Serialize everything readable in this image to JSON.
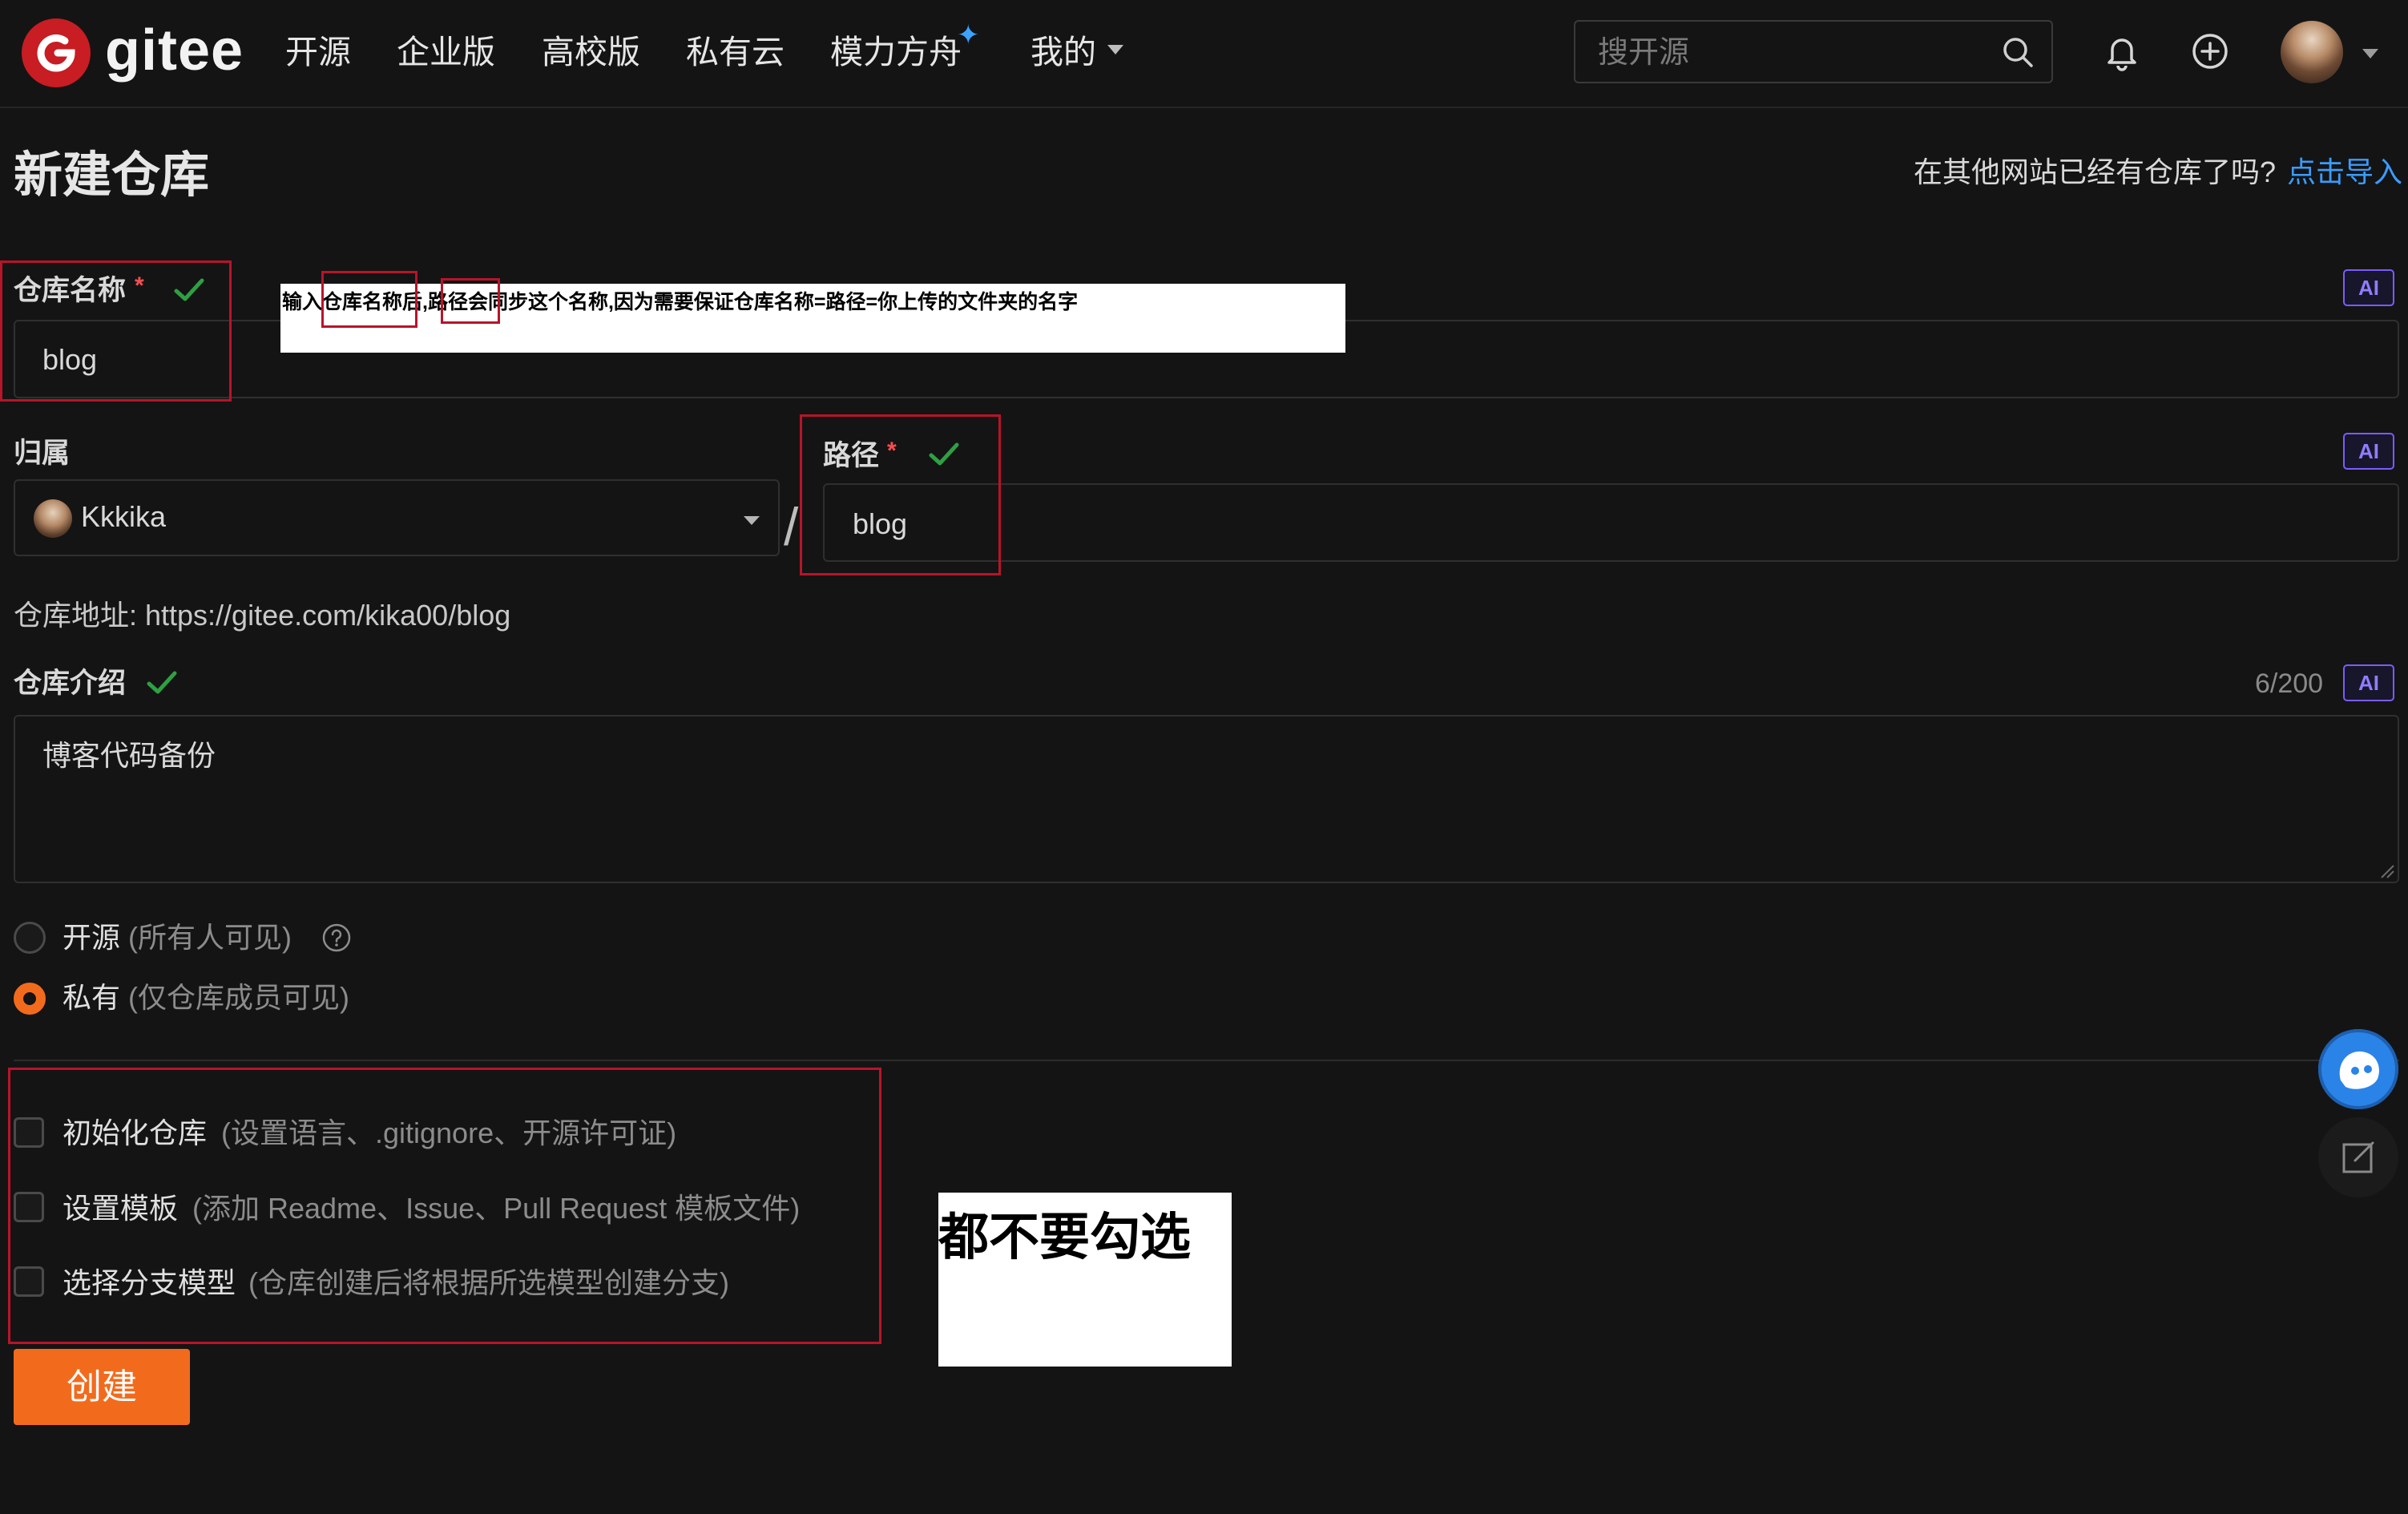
{
  "nav": {
    "brand": "gitee",
    "items": [
      "开源",
      "企业版",
      "高校版",
      "私有云",
      "模力方舟",
      "我的"
    ],
    "search_placeholder": "搜开源"
  },
  "page": {
    "title": "新建仓库",
    "import_question": "在其他网站已经有仓库了吗?",
    "import_link": "点击导入"
  },
  "form": {
    "repo_name_label": "仓库名称",
    "repo_name_value": "blog",
    "required_mark": "*",
    "ai_label": "AI",
    "owner_label": "归属",
    "owner_value": "Kkkika",
    "separator": "/",
    "path_label": "路径",
    "path_value": "blog",
    "repo_url": "仓库地址: https://gitee.com/kika00/blog",
    "intro_label": "仓库介绍",
    "intro_counter": "6/200",
    "intro_value": "博客代码备份",
    "visibility": [
      {
        "label": "开源",
        "hint": "(所有人可见)",
        "selected": false
      },
      {
        "label": "私有",
        "hint": "(仅仓库成员可见)",
        "selected": true
      }
    ],
    "options": [
      {
        "label": "初始化仓库",
        "hint": "(设置语言、.gitignore、开源许可证)",
        "checked": false
      },
      {
        "label": "设置模板",
        "hint": "(添加 Readme、Issue、Pull Request 模板文件)",
        "checked": false
      },
      {
        "label": "选择分支模型",
        "hint": "(仓库创建后将根据所选模型创建分支)",
        "checked": false
      }
    ],
    "submit_label": "创建"
  },
  "annotations": {
    "name_path_note": "输入仓库名称后,路径会同步这个名称,因为需要保证仓库名称=路径=你上传的文件夹的名字",
    "no_check_note": "都不要勾选"
  },
  "colors": {
    "accent": "#f26b1d",
    "link": "#3b9cff",
    "brand": "#c71d23",
    "valid": "#2ea043",
    "annotation_border": "#b8142a"
  }
}
